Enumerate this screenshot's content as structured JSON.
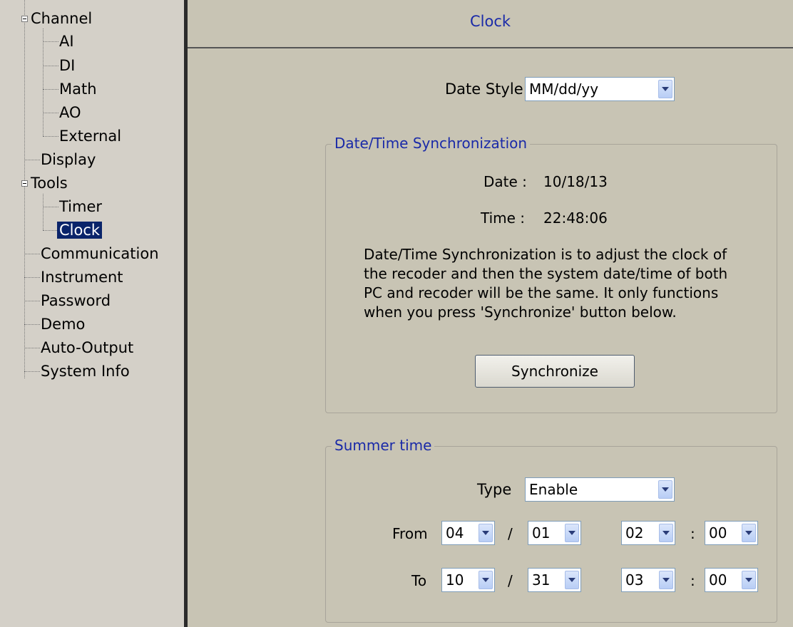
{
  "tree": {
    "items": [
      {
        "label": "Channel"
      },
      {
        "label": "AI"
      },
      {
        "label": "DI"
      },
      {
        "label": "Math"
      },
      {
        "label": "AO"
      },
      {
        "label": "External"
      },
      {
        "label": "Display"
      },
      {
        "label": "Tools"
      },
      {
        "label": "Timer"
      },
      {
        "label": "Clock"
      },
      {
        "label": "Communication"
      },
      {
        "label": "Instrument"
      },
      {
        "label": "Password"
      },
      {
        "label": "Demo"
      },
      {
        "label": "Auto-Output"
      },
      {
        "label": "System Info"
      }
    ],
    "selected": "Clock"
  },
  "panel": {
    "title": "Clock",
    "date_style": {
      "label": "Date Style",
      "value": "MM/dd/yy"
    },
    "sync": {
      "title": "Date/Time Synchronization",
      "date_label": "Date :",
      "date_value": "10/18/13",
      "time_label": "Time :",
      "time_value": "22:48:06",
      "desc_lines": [
        "Date/Time Synchronization is to adjust the clock of",
        "the recoder and then the system date/time of both",
        "PC and recoder will be the same. It only functions",
        "when you press 'Synchronize' button below."
      ],
      "button": "Synchronize"
    },
    "summer": {
      "title": "Summer time",
      "type_label": "Type",
      "type_value": "Enable",
      "from_label": "From",
      "to_label": "To",
      "date_sep": "/",
      "time_sep": ":",
      "from": {
        "month": "04",
        "day": "01",
        "hour": "02",
        "minute": "00"
      },
      "to": {
        "month": "10",
        "day": "31",
        "hour": "03",
        "minute": "00"
      }
    }
  },
  "colors": {
    "tree_bg": "#d4d0c8",
    "panel_bg": "#c8c4b4",
    "title_blue": "#1a2aa8",
    "selection": "#0a246a"
  }
}
